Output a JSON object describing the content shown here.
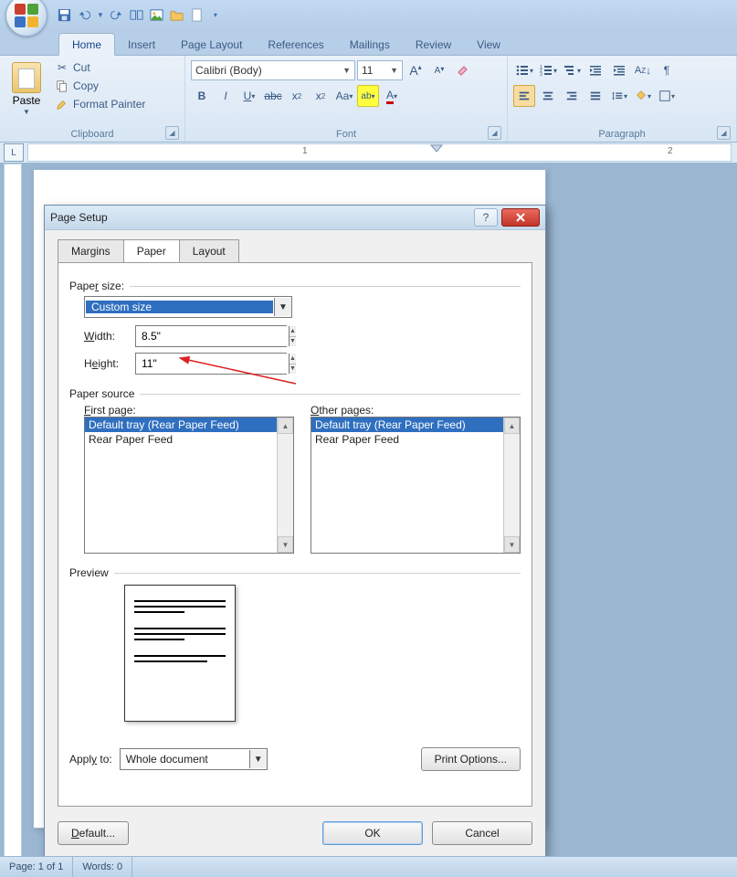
{
  "qat": {
    "save_icon": "save-icon",
    "undo_icon": "undo-icon",
    "redo_icon": "redo-icon"
  },
  "ribbon_tabs": [
    "Home",
    "Insert",
    "Page Layout",
    "References",
    "Mailings",
    "Review",
    "View"
  ],
  "ribbon_active_tab": "Home",
  "clipboard": {
    "paste": "Paste",
    "cut": "Cut",
    "copy": "Copy",
    "format_painter": "Format Painter",
    "group_label": "Clipboard"
  },
  "font": {
    "font_name": "Calibri (Body)",
    "font_size": "11",
    "group_label": "Font"
  },
  "paragraph": {
    "group_label": "Paragraph"
  },
  "ruler": {
    "marks": [
      "1",
      "2"
    ]
  },
  "dialog": {
    "title": "Page Setup",
    "tabs": [
      "Margins",
      "Paper",
      "Layout"
    ],
    "active_tab": "Paper",
    "paper_size_label": "Paper size:",
    "paper_size_value": "Custom size",
    "width_label": "Width:",
    "width_value": "8.5\"",
    "height_label": "Height:",
    "height_value": "11\"",
    "paper_source_label": "Paper source",
    "first_page_label": "First page:",
    "other_pages_label": "Other pages:",
    "source_options": [
      "Default tray (Rear Paper Feed)",
      "Rear Paper Feed"
    ],
    "preview_label": "Preview",
    "apply_to_label": "Apply to:",
    "apply_to_value": "Whole document",
    "print_options": "Print Options...",
    "default_btn": "Default...",
    "ok_btn": "OK",
    "cancel_btn": "Cancel"
  },
  "statusbar": {
    "page": "Page: 1 of 1",
    "words": "Words: 0"
  }
}
